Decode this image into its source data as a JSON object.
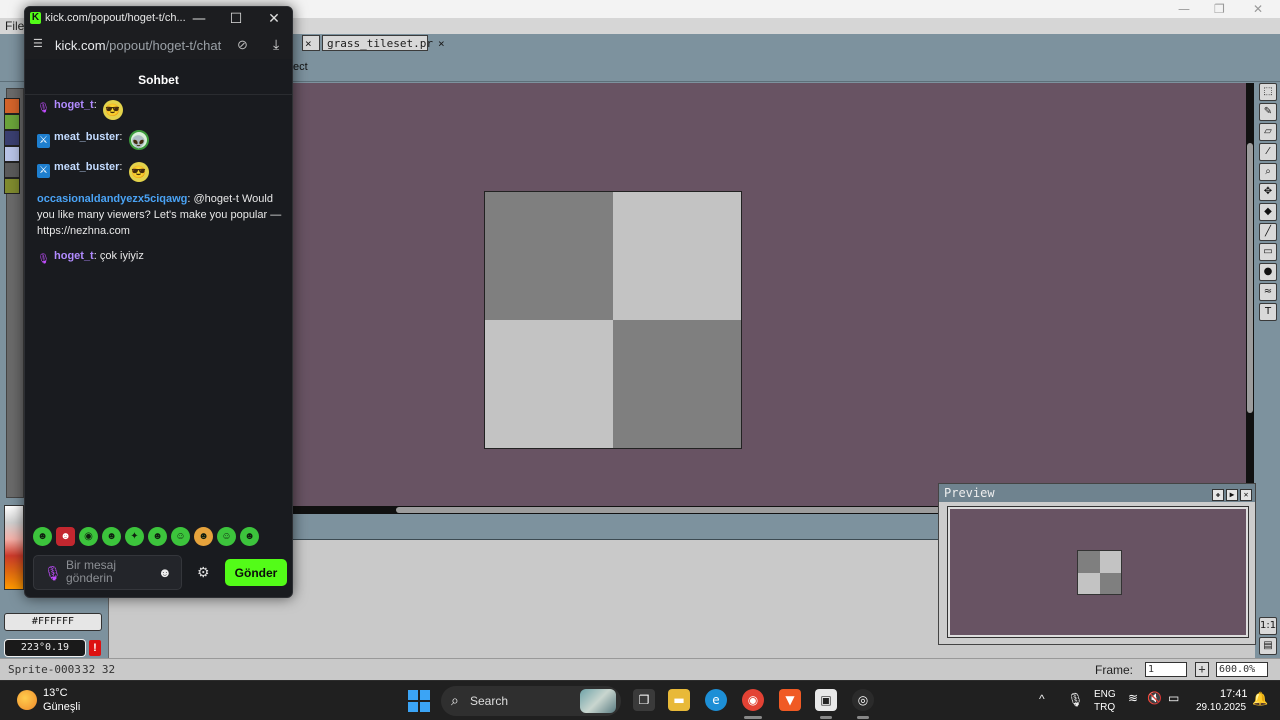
{
  "aseprite": {
    "menu_file": "File",
    "tabs": [
      {
        "label": "×"
      },
      {
        "label": "grass_tileset.pr",
        "close": "×"
      }
    ],
    "context_label": "ect",
    "status": {
      "sprite_name": "Sprite-0003",
      "sprite_size": "32 32",
      "frame_label": "Frame:",
      "frame_value": "1",
      "zoom_value": "600.0%"
    },
    "color_hex": "#FFFFFF",
    "color_hsv": "223°0.19",
    "preview_title": "Preview",
    "palette_colors": [
      "#d2632a",
      "#6aa33a",
      "#3a3f70",
      "#b8c3e6",
      "#5a5a5a",
      "#7f8a2e"
    ],
    "sprite_colors": {
      "dark": "#7f7f7f",
      "light": "#c3c3c3",
      "canvas_bg": "#685363"
    }
  },
  "chat_window": {
    "title": "kick.com/popout/hoget-t/ch...",
    "url_host": "kick.com",
    "url_path": "/popout/hoget-t/chat",
    "heading": "Sohbet",
    "messages": [
      {
        "user": "hoget_t",
        "text": "",
        "badge": "mic-icon",
        "emote": "yellow-emote"
      },
      {
        "user": "meat_buster",
        "text": "",
        "badge": "sword-badge-icon",
        "emote": "alien-emote"
      },
      {
        "user": "meat_buster",
        "text": "",
        "badge": "sword-badge-icon",
        "emote": "yellow-emote"
      },
      {
        "user": "occasionaldandyezx5ciqawg",
        "text": "@hoget-t Would you like many viewers? Let's make you popular — https://nezhna.com"
      },
      {
        "user": "hoget_t",
        "text": "çok iyiyiz",
        "badge": "mic-icon"
      }
    ],
    "input_placeholder": "Bir mesaj gönderin",
    "send_label": "Gönder",
    "accent": "#53fc18"
  },
  "taskbar": {
    "weather_temp": "13°C",
    "weather_desc": "Güneşli",
    "search_label": "Search",
    "lang_line1": "ENG",
    "lang_line2": "TRQ",
    "time": "17:41",
    "date": "29.10.2025"
  }
}
